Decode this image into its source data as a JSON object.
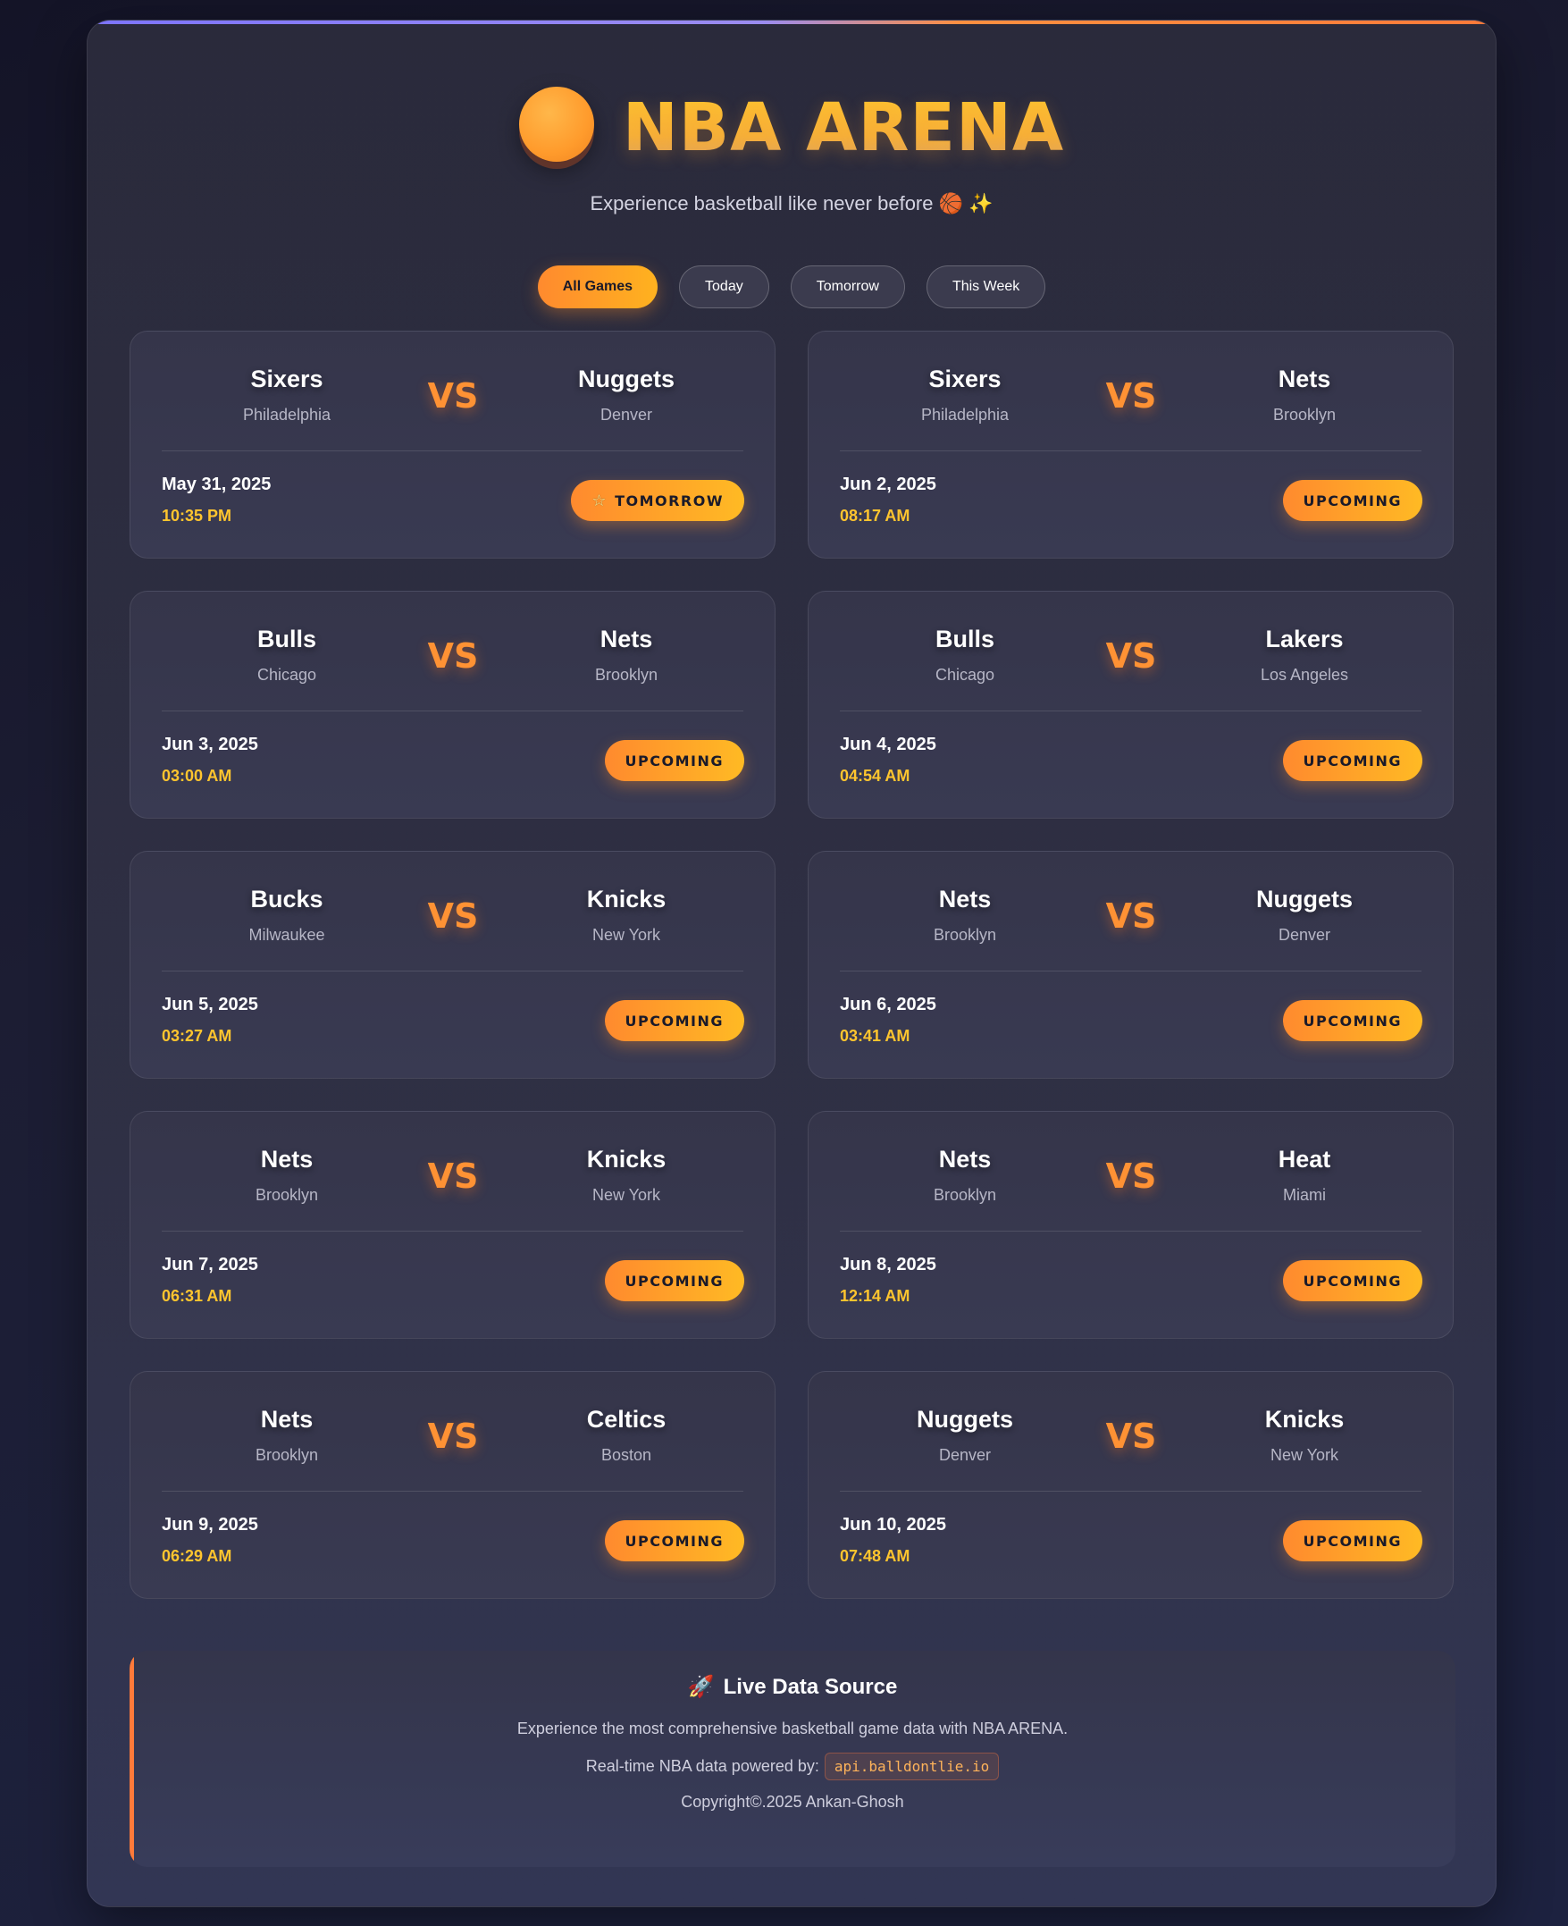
{
  "header": {
    "brand": "NBA ARENA",
    "tagline": "Experience basketball like never before 🏀 ✨"
  },
  "filters": [
    {
      "label": "All Games",
      "active": true
    },
    {
      "label": "Today",
      "active": false
    },
    {
      "label": "Tomorrow",
      "active": false
    },
    {
      "label": "This Week",
      "active": false
    }
  ],
  "vs_label": "VS",
  "games": [
    {
      "home": {
        "name": "Sixers",
        "city": "Philadelphia"
      },
      "away": {
        "name": "Nuggets",
        "city": "Denver"
      },
      "date": "May 31, 2025",
      "time": "10:35 PM",
      "status": "TOMORROW",
      "status_icon": "star-icon"
    },
    {
      "home": {
        "name": "Sixers",
        "city": "Philadelphia"
      },
      "away": {
        "name": "Nets",
        "city": "Brooklyn"
      },
      "date": "Jun 2, 2025",
      "time": "08:17 AM",
      "status": "UPCOMING"
    },
    {
      "home": {
        "name": "Bulls",
        "city": "Chicago"
      },
      "away": {
        "name": "Nets",
        "city": "Brooklyn"
      },
      "date": "Jun 3, 2025",
      "time": "03:00 AM",
      "status": "UPCOMING"
    },
    {
      "home": {
        "name": "Bulls",
        "city": "Chicago"
      },
      "away": {
        "name": "Lakers",
        "city": "Los Angeles"
      },
      "date": "Jun 4, 2025",
      "time": "04:54 AM",
      "status": "UPCOMING"
    },
    {
      "home": {
        "name": "Bucks",
        "city": "Milwaukee"
      },
      "away": {
        "name": "Knicks",
        "city": "New York"
      },
      "date": "Jun 5, 2025",
      "time": "03:27 AM",
      "status": "UPCOMING"
    },
    {
      "home": {
        "name": "Nets",
        "city": "Brooklyn"
      },
      "away": {
        "name": "Nuggets",
        "city": "Denver"
      },
      "date": "Jun 6, 2025",
      "time": "03:41 AM",
      "status": "UPCOMING"
    },
    {
      "home": {
        "name": "Nets",
        "city": "Brooklyn"
      },
      "away": {
        "name": "Knicks",
        "city": "New York"
      },
      "date": "Jun 7, 2025",
      "time": "06:31 AM",
      "status": "UPCOMING"
    },
    {
      "home": {
        "name": "Nets",
        "city": "Brooklyn"
      },
      "away": {
        "name": "Heat",
        "city": "Miami"
      },
      "date": "Jun 8, 2025",
      "time": "12:14 AM",
      "status": "UPCOMING"
    },
    {
      "home": {
        "name": "Nets",
        "city": "Brooklyn"
      },
      "away": {
        "name": "Celtics",
        "city": "Boston"
      },
      "date": "Jun 9, 2025",
      "time": "06:29 AM",
      "status": "UPCOMING"
    },
    {
      "home": {
        "name": "Nuggets",
        "city": "Denver"
      },
      "away": {
        "name": "Knicks",
        "city": "New York"
      },
      "date": "Jun 10, 2025",
      "time": "07:48 AM",
      "status": "UPCOMING"
    }
  ],
  "source": {
    "title": "Live Data Source",
    "description": "Experience the most comprehensive basketball game data with NBA ARENA.",
    "powered_by": "Real-time NBA data powered by:",
    "api": "api.balldontlie.io",
    "copyright": "Copyright©.2025 Ankan-Ghosh"
  },
  "colors": {
    "accent": "#ff8a2e",
    "gold": "#ffc52e",
    "background": "#1c1d33",
    "card": "#35354a"
  }
}
